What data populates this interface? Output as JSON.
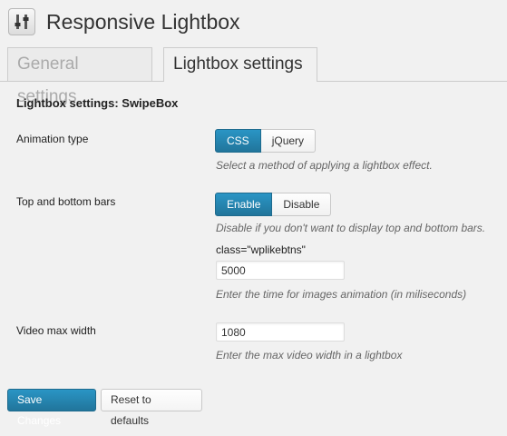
{
  "header": {
    "title": "Responsive Lightbox",
    "icon": "settings-sliders-icon"
  },
  "tabs": [
    {
      "label": "General settings",
      "active": false
    },
    {
      "label": "Lightbox settings",
      "active": true
    }
  ],
  "section": {
    "title": "Lightbox settings: SwipeBox"
  },
  "animation": {
    "label": "Animation type",
    "options": [
      "CSS",
      "jQuery"
    ],
    "selected": "CSS",
    "description": "Select a method of applying a lightbox effect."
  },
  "bars": {
    "label": "Top and bottom bars",
    "options": [
      "Enable",
      "Disable"
    ],
    "selected": "Enable",
    "description": "Disable if you don't want to display top and bottom bars.",
    "extra_text": "class=\"wplikebtns\"",
    "time_value": "5000",
    "time_description": "Enter the time for images animation (in miliseconds)"
  },
  "video": {
    "label": "Video max width",
    "value": "1080",
    "description": "Enter the max video width in a lightbox"
  },
  "actions": {
    "save_label": "Save Changes",
    "reset_label": "Reset to defaults"
  },
  "colors": {
    "accent": "#21759b",
    "background": "#f1f1f1"
  }
}
